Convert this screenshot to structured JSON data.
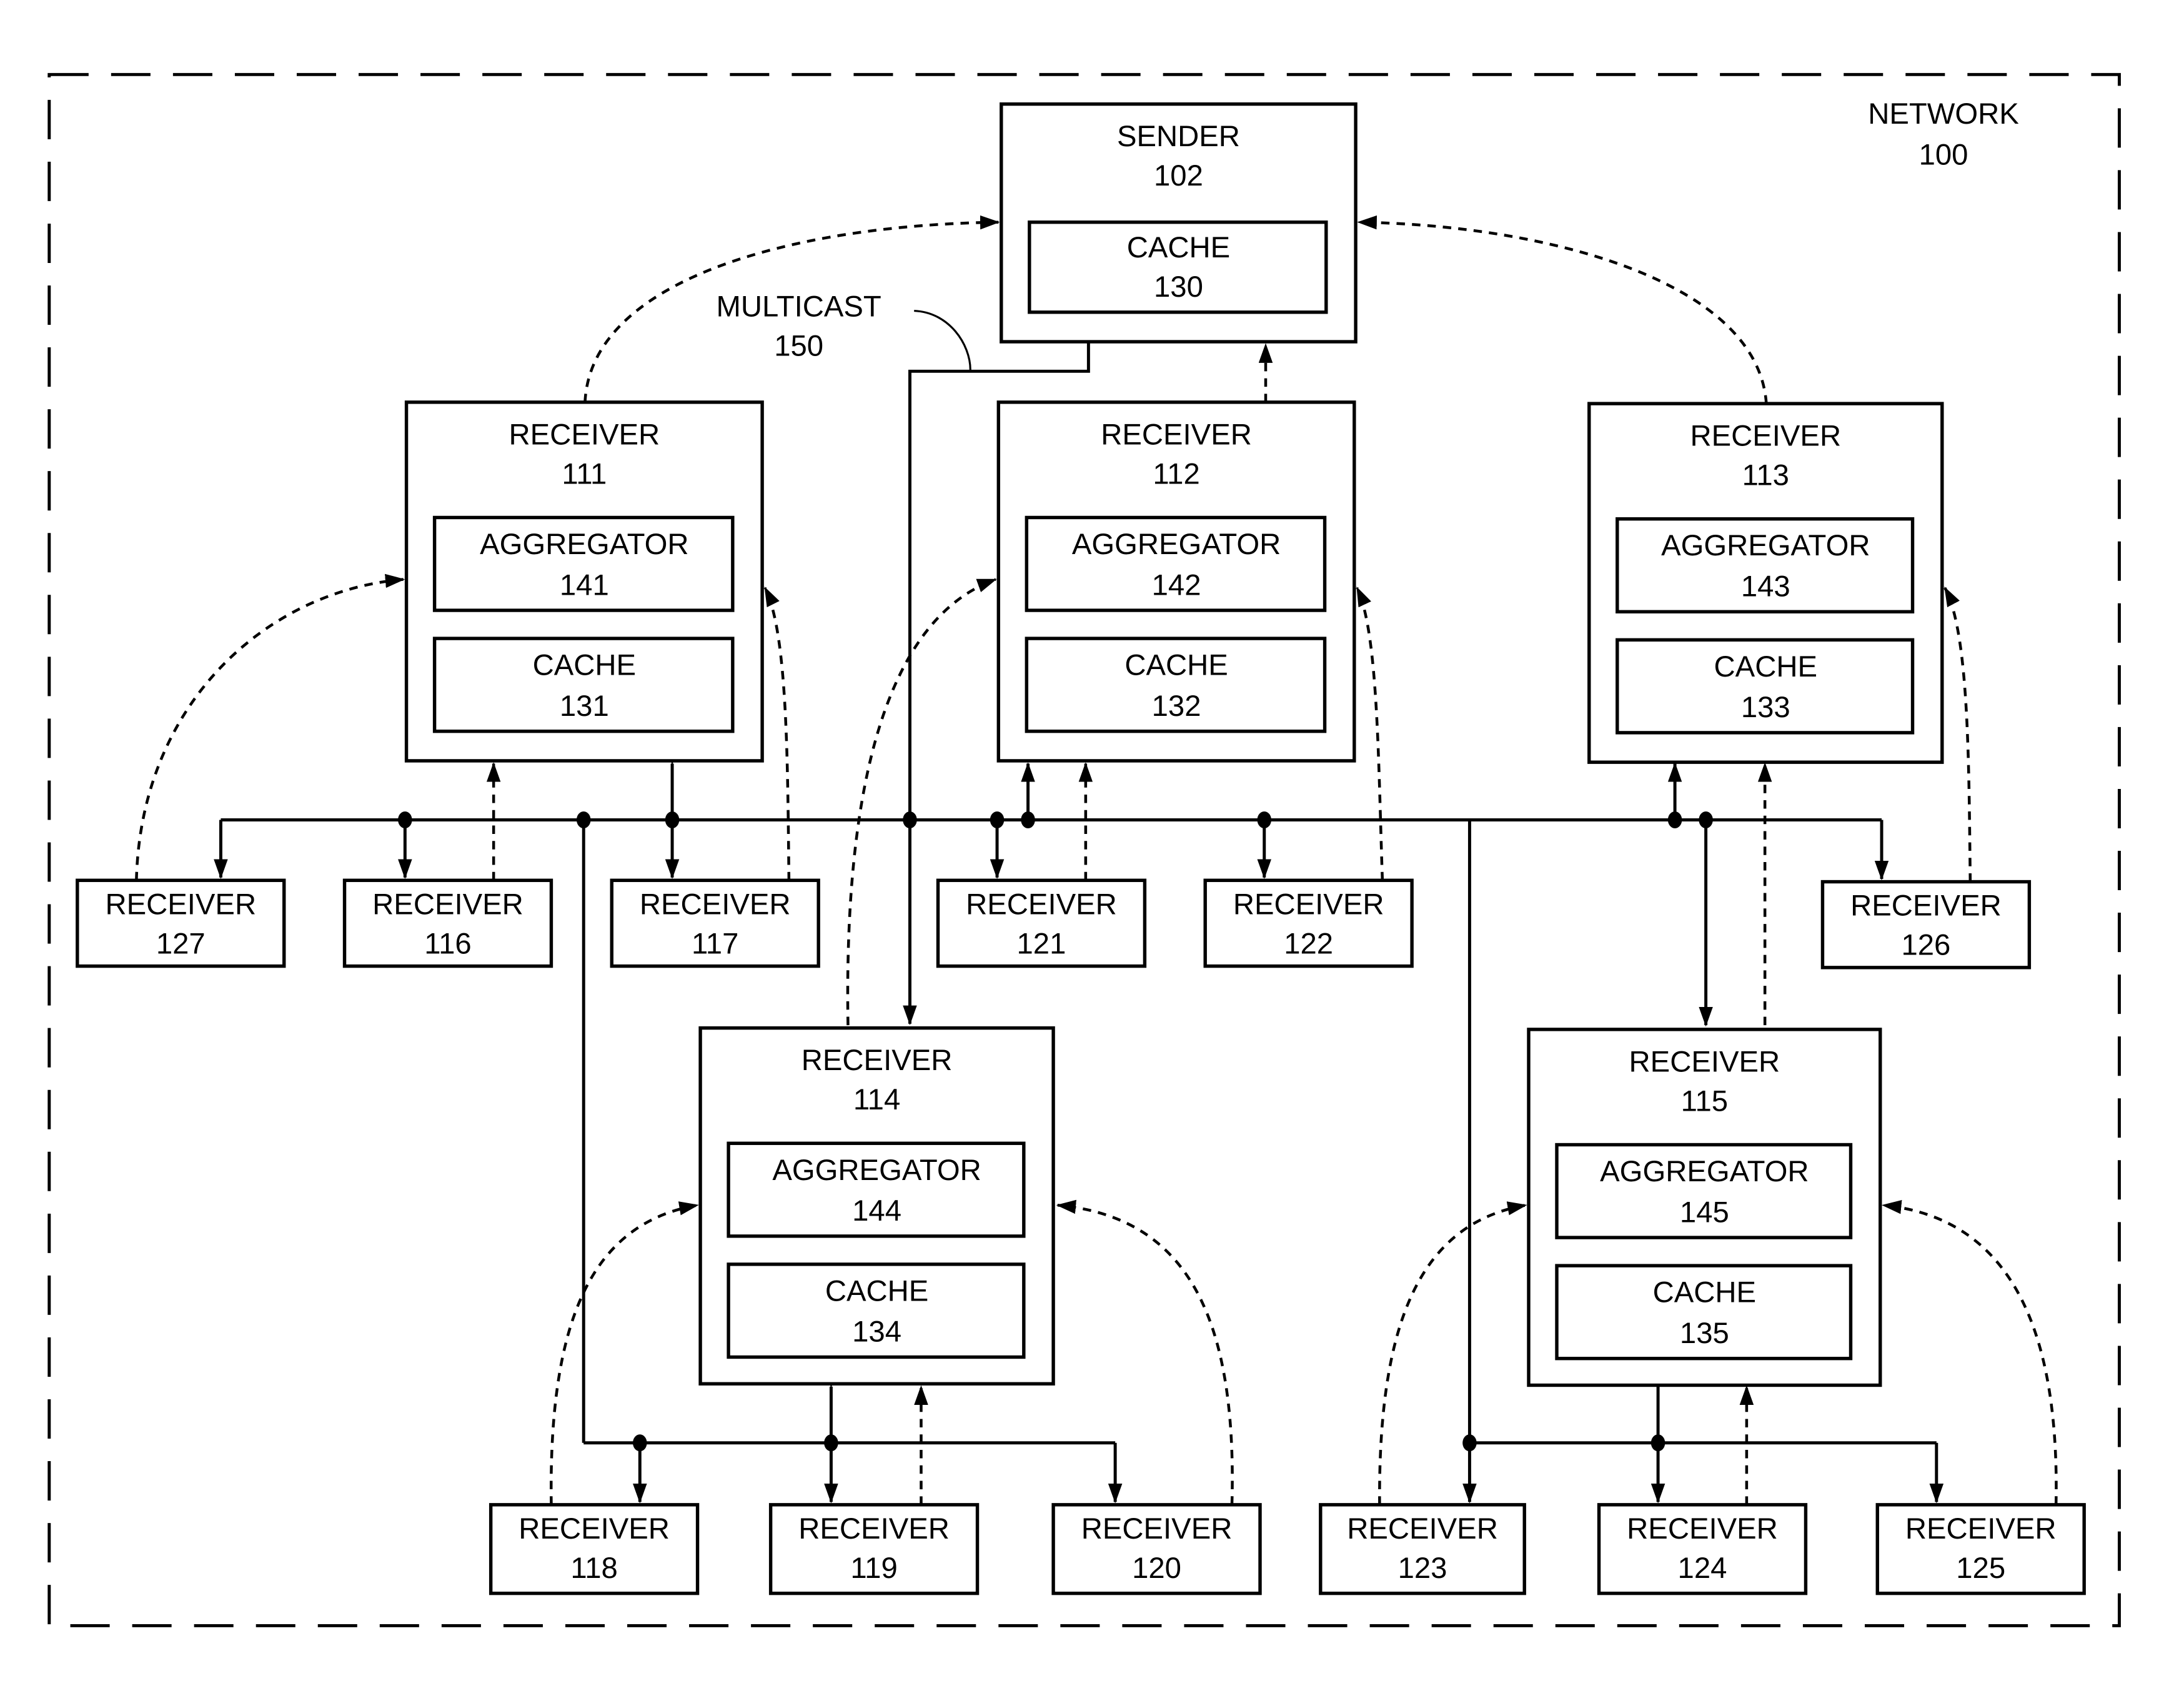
{
  "network": {
    "label": "NETWORK",
    "id": "100"
  },
  "multicast": {
    "label": "MULTICAST",
    "id": "150"
  },
  "sender": {
    "label": "SENDER",
    "id": "102",
    "cache": {
      "label": "CACHE",
      "id": "130"
    }
  },
  "receivers_main": [
    {
      "key": "r111",
      "label": "RECEIVER",
      "id": "111",
      "aggregator": {
        "label": "AGGREGATOR",
        "id": "141"
      },
      "cache": {
        "label": "CACHE",
        "id": "131"
      }
    },
    {
      "key": "r112",
      "label": "RECEIVER",
      "id": "112",
      "aggregator": {
        "label": "AGGREGATOR",
        "id": "142"
      },
      "cache": {
        "label": "CACHE",
        "id": "132"
      }
    },
    {
      "key": "r113",
      "label": "RECEIVER",
      "id": "113",
      "aggregator": {
        "label": "AGGREGATOR",
        "id": "143"
      },
      "cache": {
        "label": "CACHE",
        "id": "133"
      }
    },
    {
      "key": "r114",
      "label": "RECEIVER",
      "id": "114",
      "aggregator": {
        "label": "AGGREGATOR",
        "id": "144"
      },
      "cache": {
        "label": "CACHE",
        "id": "134"
      }
    },
    {
      "key": "r115",
      "label": "RECEIVER",
      "id": "115",
      "aggregator": {
        "label": "AGGREGATOR",
        "id": "145"
      },
      "cache": {
        "label": "CACHE",
        "id": "135"
      }
    }
  ],
  "receivers_leaf": [
    {
      "key": "r127",
      "label": "RECEIVER",
      "id": "127"
    },
    {
      "key": "r116",
      "label": "RECEIVER",
      "id": "116"
    },
    {
      "key": "r117",
      "label": "RECEIVER",
      "id": "117"
    },
    {
      "key": "r121",
      "label": "RECEIVER",
      "id": "121"
    },
    {
      "key": "r122",
      "label": "RECEIVER",
      "id": "122"
    },
    {
      "key": "r126",
      "label": "RECEIVER",
      "id": "126"
    },
    {
      "key": "r118",
      "label": "RECEIVER",
      "id": "118"
    },
    {
      "key": "r119",
      "label": "RECEIVER",
      "id": "119"
    },
    {
      "key": "r120",
      "label": "RECEIVER",
      "id": "120"
    },
    {
      "key": "r123",
      "label": "RECEIVER",
      "id": "123"
    },
    {
      "key": "r124",
      "label": "RECEIVER",
      "id": "124"
    },
    {
      "key": "r125",
      "label": "RECEIVER",
      "id": "125"
    }
  ]
}
